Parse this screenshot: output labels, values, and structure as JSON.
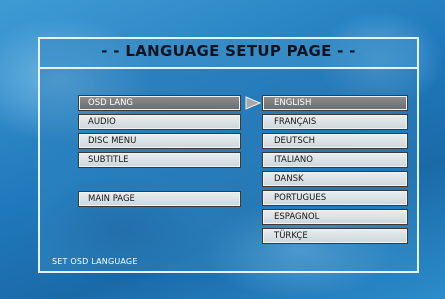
{
  "title": "- - LANGUAGE SETUP PAGE - -",
  "left_menu": [
    {
      "label": "OSD LANG",
      "selected": true
    },
    {
      "label": "AUDIO",
      "selected": false
    },
    {
      "label": "DISC MENU",
      "selected": false
    },
    {
      "label": "SUBTITLE",
      "selected": false
    },
    {
      "label": "MAIN PAGE",
      "selected": false
    }
  ],
  "language_options": [
    {
      "label": "ENGLISH",
      "selected": true
    },
    {
      "label": "FRANÇAIS",
      "selected": false
    },
    {
      "label": "DEUTSCH",
      "selected": false
    },
    {
      "label": "ITALIANO",
      "selected": false
    },
    {
      "label": "DANSK",
      "selected": false
    },
    {
      "label": "PORTUGUES",
      "selected": false
    },
    {
      "label": "ESPAGNOL",
      "selected": false
    },
    {
      "label": "TÜRKÇE",
      "selected": false
    }
  ],
  "status": "SET OSD LANGUAGE",
  "arrow_icon": "triangle-right-icon",
  "colors": {
    "highlight": "#7c7c7c",
    "button": "#dce3e7",
    "background": "#1f74b1"
  }
}
